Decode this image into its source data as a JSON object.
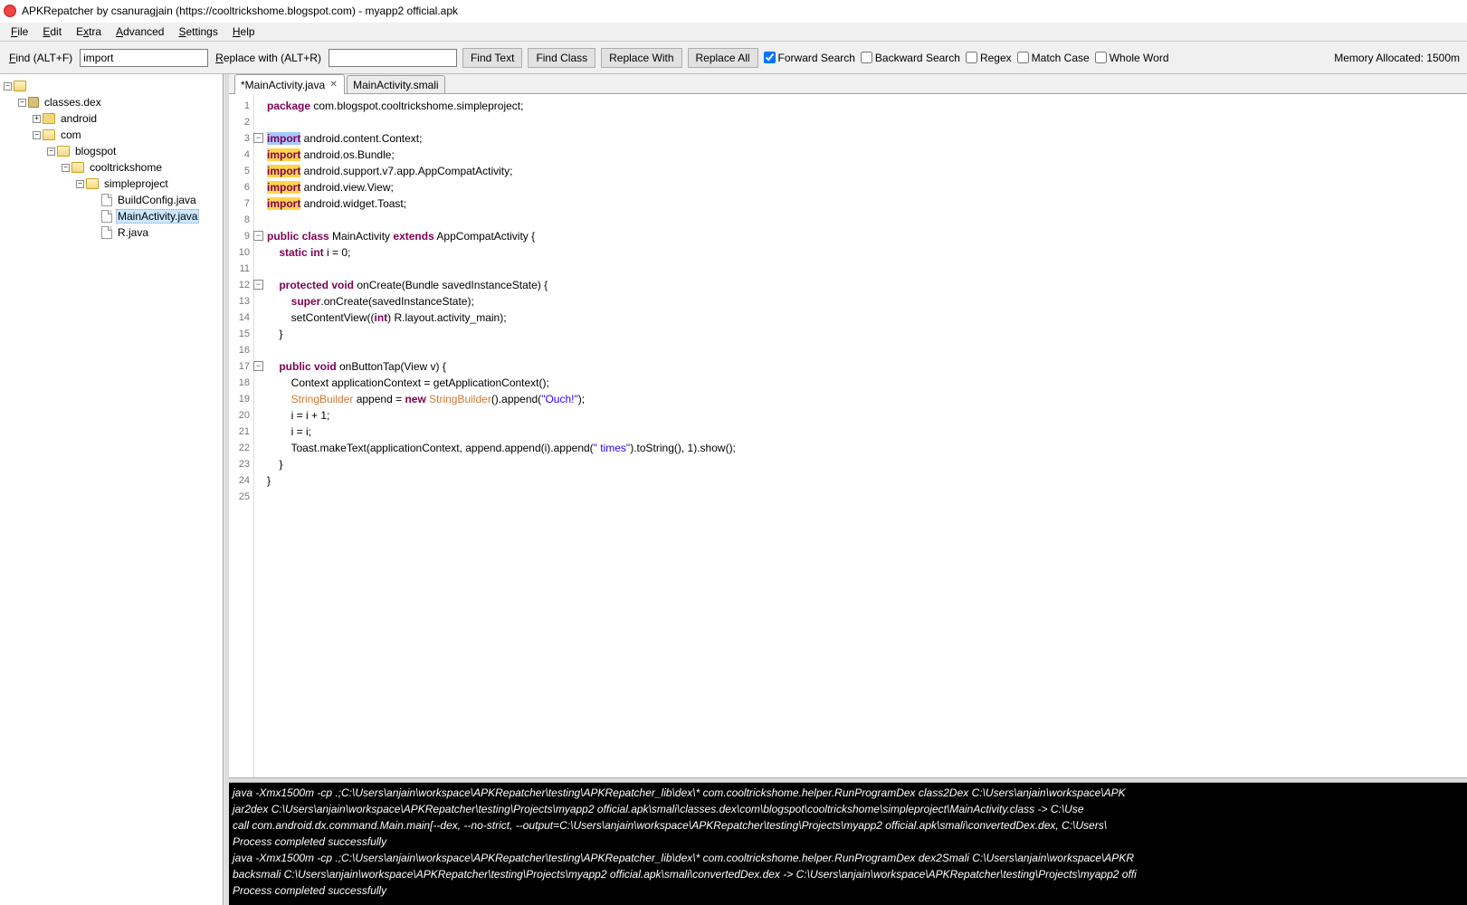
{
  "window_title": "APKRepatcher by csanuragjain (https://cooltrickshome.blogspot.com) - myapp2 official.apk",
  "menu": {
    "file": "File",
    "edit": "Edit",
    "extra": "Extra",
    "advanced": "Advanced",
    "settings": "Settings",
    "help": "Help"
  },
  "toolbar": {
    "find_label": "Find (ALT+F)",
    "find_value": "import",
    "replace_label": "Replace with (ALT+R)",
    "replace_value": "",
    "find_text": "Find Text",
    "find_class": "Find Class",
    "replace_with": "Replace With",
    "replace_all": "Replace All",
    "forward": "Forward Search",
    "backward": "Backward Search",
    "regex": "Regex",
    "match_case": "Match Case",
    "whole_word": "Whole Word",
    "memory": "Memory Allocated: 1500m"
  },
  "tree": {
    "root": "classes.dex",
    "n1": "android",
    "n2": "com",
    "n3": "blogspot",
    "n4": "cooltrickshome",
    "n5": "simpleproject",
    "f1": "BuildConfig.java",
    "f2": "MainActivity.java",
    "f3": "R.java"
  },
  "tabs": {
    "t1": "*MainActivity.java",
    "t2": "MainActivity.smali"
  },
  "code": {
    "l1_a": "package",
    "l1_b": " com.blogspot.cooltrickshome.simpleproject;",
    "l3_a": "import",
    "l3_b": " android.content.Context;",
    "l4_a": "import",
    "l4_b": " android.os.Bundle;",
    "l5_a": "import",
    "l5_b": " android.support.v7.app.AppCompatActivity;",
    "l6_a": "import",
    "l6_b": " android.view.View;",
    "l7_a": "import",
    "l7_b": " android.widget.Toast;",
    "l9_a": "public class",
    "l9_b": " MainActivity ",
    "l9_c": "extends",
    "l9_d": " AppCompatActivity {",
    "l10_a": "    static int",
    "l10_b": " i = 0;",
    "l12_a": "    protected void",
    "l12_b": " onCreate(Bundle savedInstanceState) {",
    "l13_a": "        super",
    "l13_b": ".onCreate(savedInstanceState);",
    "l14_a": "        setContentView((",
    "l14_b": "int",
    "l14_c": ") R.layout.activity_main);",
    "l15": "    }",
    "l17_a": "    public void",
    "l17_b": " onButtonTap(View v) {",
    "l18": "        Context applicationContext = getApplicationContext();",
    "l19_a": "        ",
    "l19_b": "StringBuilder",
    "l19_c": " append = ",
    "l19_d": "new ",
    "l19_e": "StringBuilder",
    "l19_f": "().append(",
    "l19_g": "\"Ouch!\"",
    "l19_h": ");",
    "l20": "        i = i + 1;",
    "l21": "        i = i;",
    "l22_a": "        Toast.makeText(applicationContext, append.append(i).append(",
    "l22_b": "\" times\"",
    "l22_c": ").toString(), 1).show();",
    "l23": "    }",
    "l24": "}"
  },
  "console": {
    "c1": "java -Xmx1500m -cp .;C:\\Users\\anjain\\workspace\\APKRepatcher\\testing\\APKRepatcher_lib\\dex\\* com.cooltrickshome.helper.RunProgramDex class2Dex C:\\Users\\anjain\\workspace\\APK",
    "c2": "jar2dex C:\\Users\\anjain\\workspace\\APKRepatcher\\testing\\Projects\\myapp2 official.apk\\smali\\classes.dex\\com\\blogspot\\cooltrickshome\\simpleproject\\MainActivity.class -> C:\\Use",
    "c3": "call com.android.dx.command.Main.main[--dex, --no-strict, --output=C:\\Users\\anjain\\workspace\\APKRepatcher\\testing\\Projects\\myapp2 official.apk\\smali\\convertedDex.dex, C:\\Users\\",
    "c4": "Process completed successfully",
    "c5": "java -Xmx1500m -cp .;C:\\Users\\anjain\\workspace\\APKRepatcher\\testing\\APKRepatcher_lib\\dex\\* com.cooltrickshome.helper.RunProgramDex dex2Smali C:\\Users\\anjain\\workspace\\APKR",
    "c6": "backsmali C:\\Users\\anjain\\workspace\\APKRepatcher\\testing\\Projects\\myapp2 official.apk\\smali\\convertedDex.dex -> C:\\Users\\anjain\\workspace\\APKRepatcher\\testing\\Projects\\myapp2 offi",
    "c7": "Process completed successfully"
  },
  "gutter": [
    "1",
    "2",
    "3",
    "4",
    "5",
    "6",
    "7",
    "8",
    "9",
    "10",
    "11",
    "12",
    "13",
    "14",
    "15",
    "16",
    "17",
    "18",
    "19",
    "20",
    "21",
    "22",
    "23",
    "24",
    "25"
  ]
}
